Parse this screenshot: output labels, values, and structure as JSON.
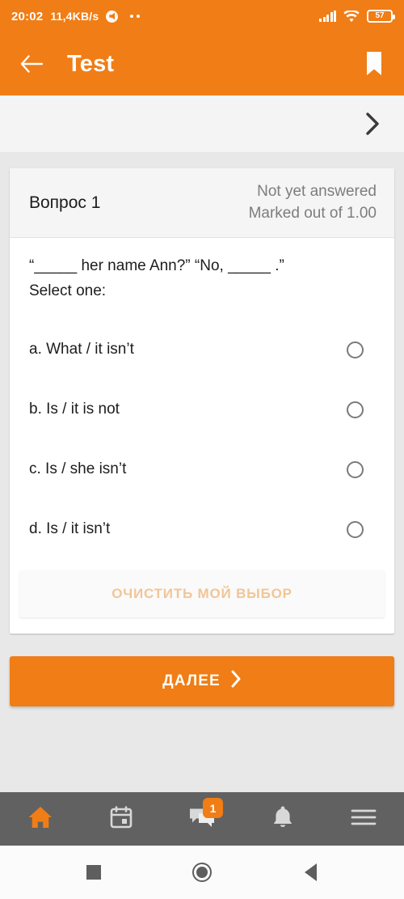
{
  "status_bar": {
    "time": "20:02",
    "data_rate": "11,4KB/s",
    "battery_level": "57",
    "icons": [
      "mute-icon",
      "more-dots-icon",
      "cellular-signal-icon",
      "wifi-icon",
      "battery-icon"
    ]
  },
  "app_bar": {
    "title": "Test",
    "back_label": "back-arrow",
    "bookmark_label": "bookmark"
  },
  "nav_strip": {
    "next_chevron": "chevron-right"
  },
  "question_card": {
    "number_label": "Вопрос 1",
    "state": "Not yet answered",
    "marks": "Marked out of 1.00",
    "text": "“_____ her name Ann?” “No, _____ .”",
    "select_prompt": "Select one:",
    "options": [
      {
        "label": "a. What / it isn’t",
        "selected": false
      },
      {
        "label": "b. Is / it is not",
        "selected": false
      },
      {
        "label": "c. Is / she isn’t",
        "selected": false
      },
      {
        "label": "d. Is / it isn’t",
        "selected": false
      }
    ],
    "clear_choice_label": "ОЧИСТИТЬ МОЙ ВЫБОР"
  },
  "next_button": {
    "label": "ДАЛЕЕ",
    "chevron": "›"
  },
  "bottom_nav": {
    "items": [
      {
        "name": "home",
        "active": true,
        "badge": null
      },
      {
        "name": "calendar",
        "active": false,
        "badge": null
      },
      {
        "name": "messages",
        "active": false,
        "badge": "1"
      },
      {
        "name": "notifications",
        "active": false,
        "badge": null
      },
      {
        "name": "menu",
        "active": false,
        "badge": null
      }
    ]
  },
  "system_nav": {
    "recents": "square",
    "home": "circle",
    "back": "triangle"
  },
  "colors": {
    "accent": "#F07D15",
    "page_bg": "#E8E8E8",
    "card_bg": "#FFFFFF",
    "bottom_nav_bg": "#616161",
    "muted_text": "#7D7D7D"
  }
}
